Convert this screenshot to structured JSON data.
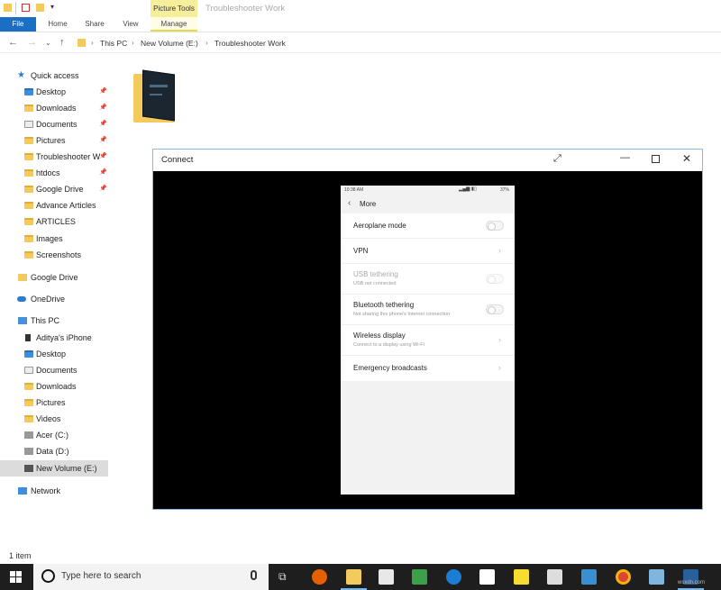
{
  "window": {
    "title": "Troubleshooter Work",
    "contextual_tab_group": "Picture Tools"
  },
  "ribbon": {
    "tabs": [
      {
        "label": "File"
      },
      {
        "label": "Home"
      },
      {
        "label": "Share"
      },
      {
        "label": "View"
      },
      {
        "label": "Manage"
      }
    ]
  },
  "address": {
    "crumbs": [
      "This PC",
      "New Volume (E:)",
      "Troubleshooter Work"
    ]
  },
  "nav": {
    "quick_access": "Quick access",
    "quick_items": [
      "Desktop",
      "Downloads",
      "Documents",
      "Pictures",
      "Troubleshooter W",
      "htdocs",
      "Google Drive",
      "Advance Articles",
      "ARTICLES",
      "Images",
      "Screenshots"
    ],
    "google_drive": "Google Drive",
    "onedrive": "OneDrive",
    "this_pc": "This PC",
    "pc_items": [
      "Aditya's iPhone",
      "Desktop",
      "Documents",
      "Downloads",
      "Pictures",
      "Videos",
      "Acer (C:)",
      "Data (D:)",
      "New Volume (E:)"
    ],
    "network": "Network"
  },
  "status": {
    "item_count": "1 item"
  },
  "connect": {
    "title": "Connect",
    "phone": {
      "time": "10:38 AM",
      "battery": "37%",
      "header": "More",
      "rows": [
        {
          "label": "Aeroplane mode",
          "sub": "",
          "control": "toggle"
        },
        {
          "label": "VPN",
          "sub": "",
          "control": "chevron"
        },
        {
          "label": "USB tethering",
          "sub": "USB not connected",
          "control": "toggle"
        },
        {
          "label": "Bluetooth tethering",
          "sub": "Not sharing this phone's Internet connection",
          "control": "toggle"
        },
        {
          "label": "Wireless display",
          "sub": "Connect to a display using Wi-Fi",
          "control": "chevron"
        },
        {
          "label": "Emergency broadcasts",
          "sub": "",
          "control": "chevron"
        }
      ]
    }
  },
  "taskbar": {
    "search_placeholder": "Type here to search",
    "watermark": "wsxdn.com"
  },
  "colors": {
    "accent": "#1a6fc5",
    "picture_tools": "#f6ee9a",
    "folder": "#f4c95d",
    "taskbar": "#1e1e1e"
  }
}
